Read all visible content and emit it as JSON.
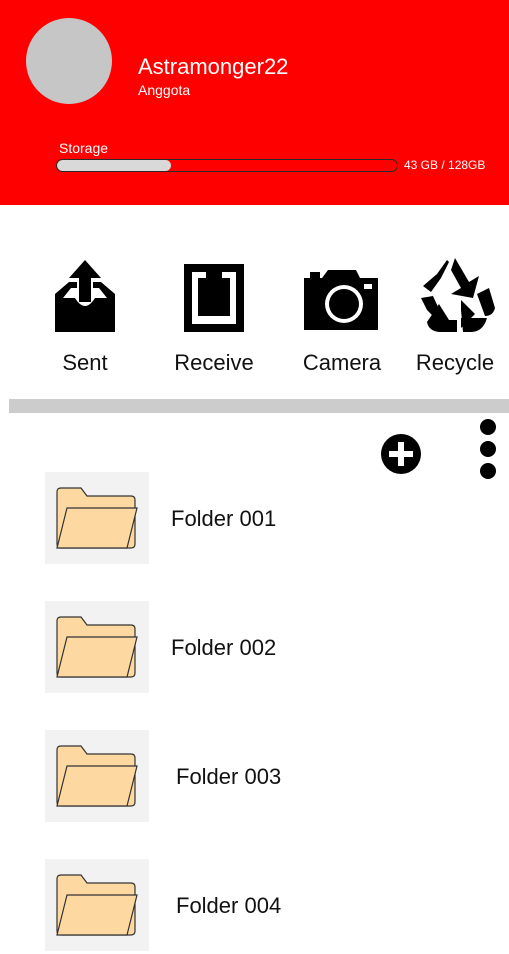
{
  "profile": {
    "username": "Astramonger22",
    "role": "Anggota"
  },
  "storage": {
    "label": "Storage",
    "used_text": "43 GB / 128GB",
    "used_fraction": 0.336
  },
  "actions": [
    {
      "label": "Sent",
      "icon": "upload-tray-icon"
    },
    {
      "label": "Receive",
      "icon": "download-tray-icon"
    },
    {
      "label": "Camera",
      "icon": "camera-icon"
    },
    {
      "label": "Recycle",
      "icon": "recycle-icon"
    }
  ],
  "toolbar": {
    "add_icon": "add-circle-icon",
    "more_icon": "more-vertical-icon"
  },
  "folders": [
    {
      "name": "Folder 001"
    },
    {
      "name": "Folder 002"
    },
    {
      "name": "Folder 003"
    },
    {
      "name": "Folder 004"
    }
  ],
  "colors": {
    "header": "#ff0000",
    "divider": "#cccccc",
    "folder_fill": "#fdd8a0"
  }
}
